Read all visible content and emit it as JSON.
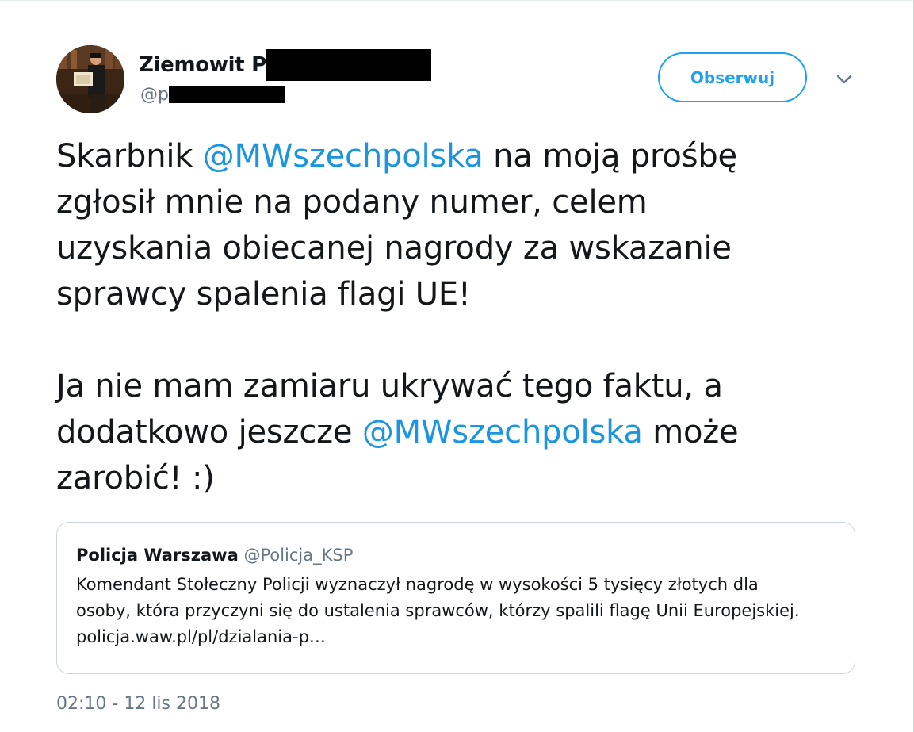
{
  "author": {
    "name_prefix": "Ziemowit P",
    "handle_prefix": "@p",
    "avatar_icon": "profile-photo"
  },
  "follow_button": {
    "label": "Obserwuj"
  },
  "menu": {
    "icon": "chevron-down-icon"
  },
  "tweet": {
    "paragraph1": {
      "t1": "Skarbnik ",
      "m1": "@MWszechpolska",
      "t2": " na moją prośbę",
      "l2": "zgłosił mnie na podany numer, celem",
      "l3": "uzyskania obiecanej nagrody za wskazanie",
      "l4": "sprawcy spalenia flagi UE!"
    },
    "paragraph2": {
      "l1": "Ja nie mam zamiaru ukrywać tego faktu, a",
      "t2a": "dodatkowo jeszcze ",
      "m2": "@MWszechpolska",
      "t2b": " może",
      "l3": "zarobić! :)"
    }
  },
  "quoted_tweet": {
    "name": "Policja Warszawa",
    "handle": "@Policja_KSP",
    "line1": "Komendant Stołeczny Policji wyznaczył nagrodę w wysokości 5 tysięcy złotych dla",
    "line2": "osoby, która przyczyni się do ustalenia sprawców, którzy spalili flagę Unii Europejskiej.",
    "line3": "policja.waw.pl/pl/dzialania-p…"
  },
  "timestamp": "02:10 - 12 lis 2018",
  "colors": {
    "accent": "#1da1f2",
    "mention": "#1b95e0",
    "text": "#14171a",
    "secondary": "#657786",
    "border": "#ccd6dd"
  }
}
